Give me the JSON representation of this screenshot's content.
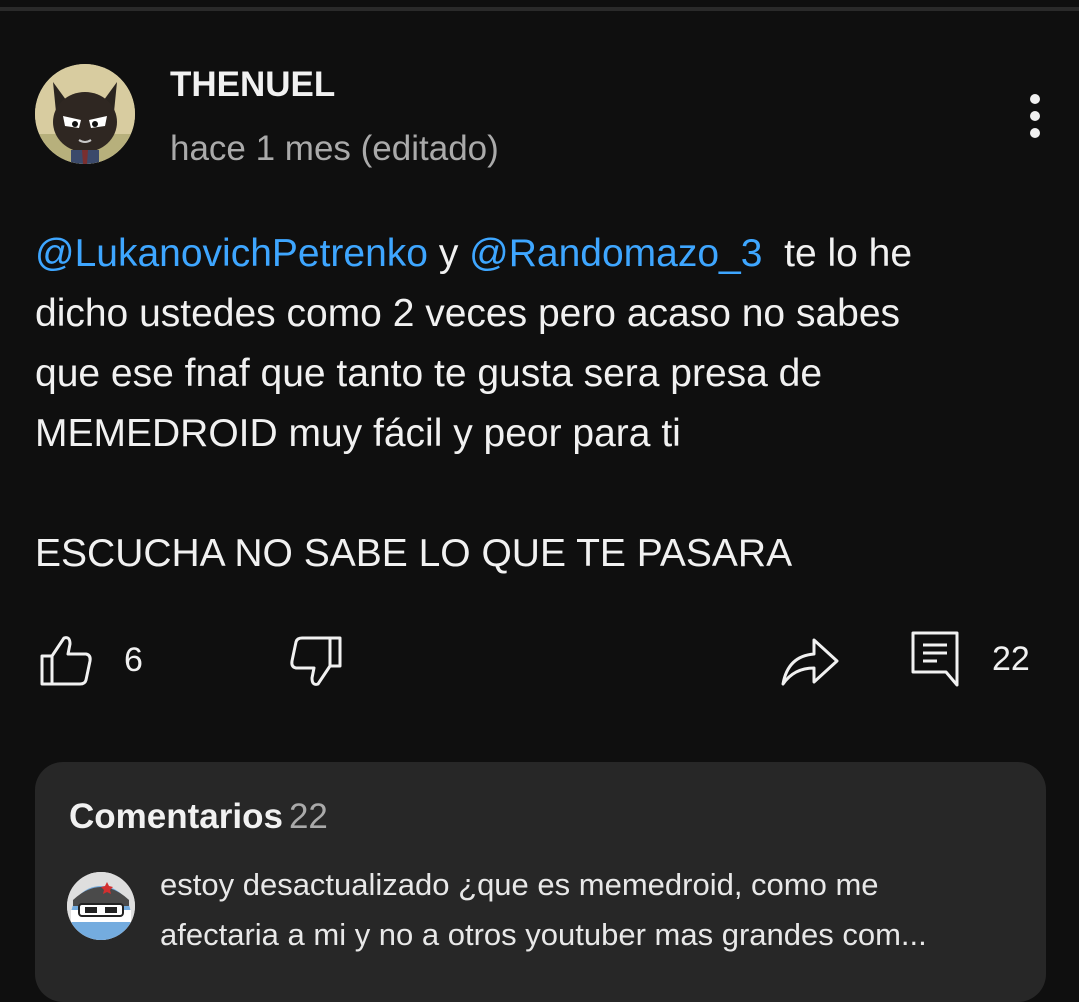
{
  "comment": {
    "author": "THENUEL",
    "timestamp": "hace 1 mes (editado)",
    "mentions": [
      "@LukanovichPetrenko",
      "@Randomazo_3"
    ],
    "conjunction": " y ",
    "body_line1_rest": "  te lo he",
    "body_line2": "dicho ustedes como 2 veces pero acaso no sabes",
    "body_line3": "que ese fnaf que tanto te gusta sera presa de",
    "body_line4": "MEMEDROID muy fácil y peor para ti",
    "body_line5": "ESCUCHA NO SABE LO QUE TE PASARA"
  },
  "actions": {
    "like_count": "6",
    "reply_count": "22",
    "icons": [
      "thumbs-up-icon",
      "thumbs-down-icon",
      "share-icon",
      "comment-icon",
      "more-vertical-icon"
    ]
  },
  "replies": {
    "title": "Comentarios",
    "count": "22",
    "preview_line1": "estoy desactualizado ¿que es memedroid, como me",
    "preview_line2": "afectaria a mi y no a otros youtuber mas grandes com..."
  },
  "colors": {
    "background": "#0f0f0f",
    "card": "#272727",
    "mention": "#3ea6ff",
    "secondary_text": "#aaaaaa"
  }
}
